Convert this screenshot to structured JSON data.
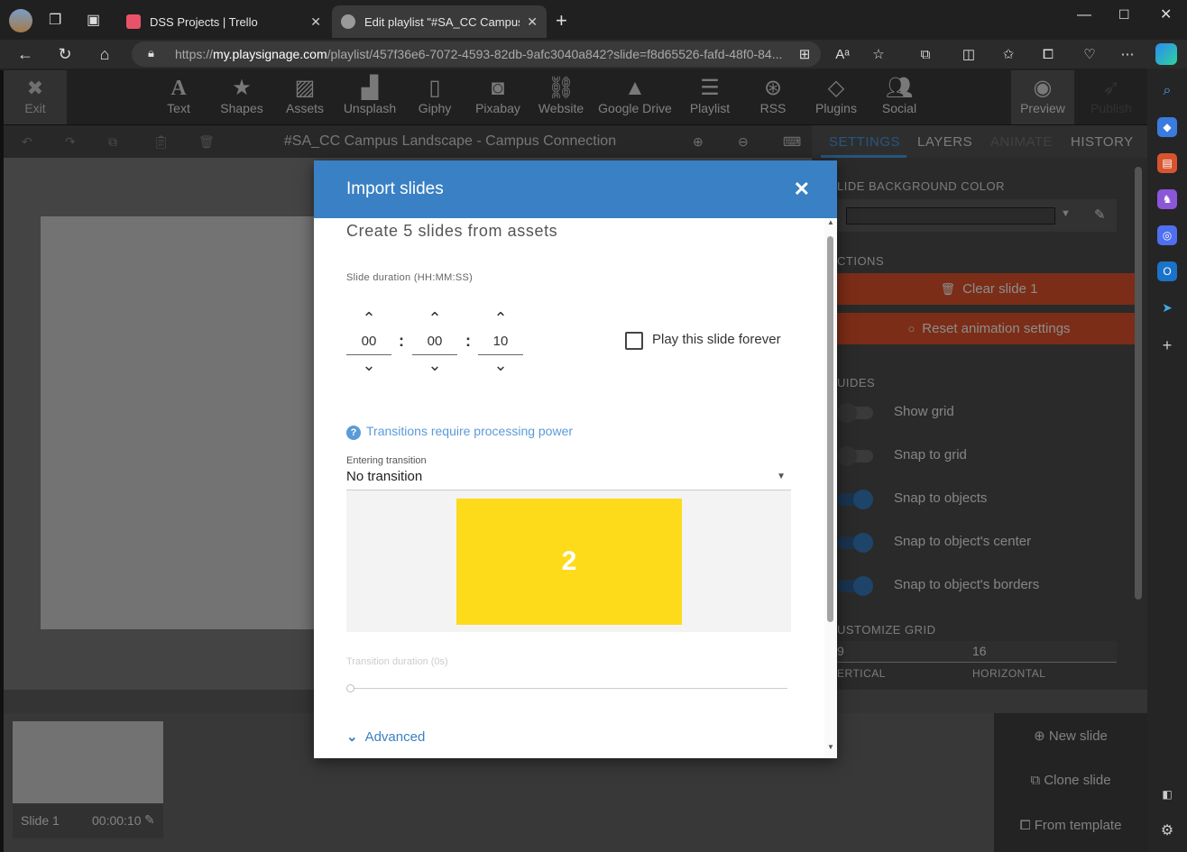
{
  "browser": {
    "tabs": [
      {
        "label": "DSS Projects | Trello"
      },
      {
        "label": "Edit playlist \"#SA_CC Campus La"
      }
    ],
    "url_prefix": "https://",
    "url_domain": "my.playsignage.com",
    "url_path": "/playlist/457f36e6-7072-4593-82db-9afc3040a842?slide=f8d65526-fafd-48f0-84..."
  },
  "toolbar": {
    "exit": "Exit",
    "items": [
      "Text",
      "Shapes",
      "Assets",
      "Unsplash",
      "Giphy",
      "Pixabay",
      "Website",
      "Google Drive",
      "Playlist",
      "RSS",
      "Plugins",
      "Social"
    ],
    "preview": "Preview",
    "publish": "Publish"
  },
  "editor": {
    "title": "#SA_CC Campus Landscape - Campus Connection"
  },
  "right_panel": {
    "tabs": [
      "SETTINGS",
      "LAYERS",
      "ANIMATE",
      "HISTORY"
    ],
    "bg_color_label": "LIDE BACKGROUND COLOR",
    "actions_label": "CTIONS",
    "clear_button": "Clear slide 1",
    "reset_button": "Reset animation settings",
    "guides_label": "UIDES",
    "toggles": [
      {
        "label": "Show grid",
        "on": false
      },
      {
        "label": "Snap to grid",
        "on": false
      },
      {
        "label": "Snap to objects",
        "on": true
      },
      {
        "label": "Snap to object's center",
        "on": true
      },
      {
        "label": "Snap to object's borders",
        "on": true
      }
    ],
    "customize_label": "USTOMIZE GRID",
    "grid_vertical_value": "9",
    "grid_horizontal_value": "16",
    "grid_vertical_label": "ERTICAL",
    "grid_horizontal_label": "HORIZONTAL"
  },
  "slides": {
    "name": "Slide 1",
    "duration": "00:00:10",
    "new_slide": "New slide",
    "clone_slide": "Clone slide",
    "from_template": "From template"
  },
  "modal": {
    "title": "Import slides",
    "heading": "Create 5 slides from assets",
    "duration_label": "Slide duration (HH:MM:SS)",
    "hours": "00",
    "minutes": "00",
    "seconds": "10",
    "forever_label": "Play this slide forever",
    "forever_checked": false,
    "transitions_note": "Transitions require processing power",
    "entering_label": "Entering transition",
    "entering_value": "No transition",
    "preview_number": "2",
    "transition_duration_label": "Transition duration (0s)",
    "transition_duration_value": 0,
    "advanced_label": "Advanced"
  },
  "colors": {
    "modal_header": "#3a80c4",
    "preview_box": "#fddb1b",
    "action_button": "#e0522a",
    "toggle_on": "#3a7cc0"
  }
}
